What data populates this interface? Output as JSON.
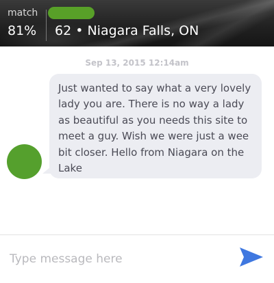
{
  "header": {
    "match_label": "match",
    "match_value": "81%",
    "profile_info": "62 • Niagara Falls, ON",
    "name_pill_color": "#58a028"
  },
  "conversation": {
    "timestamp": "Sep 13, 2015 12:14am",
    "messages": [
      {
        "text": "Just wanted to say what a very lovely lady you are. There is no way a lady as beautiful as you needs this site to meet a guy. Wish we were just a wee bit closer. Hello from Niagara on the Lake",
        "avatar_color": "#55a02d",
        "bubble_color": "#ecedf2"
      }
    ]
  },
  "composer": {
    "placeholder": "Type message here",
    "value": "",
    "send_icon": "send-icon",
    "send_color": "#3f78e0"
  }
}
